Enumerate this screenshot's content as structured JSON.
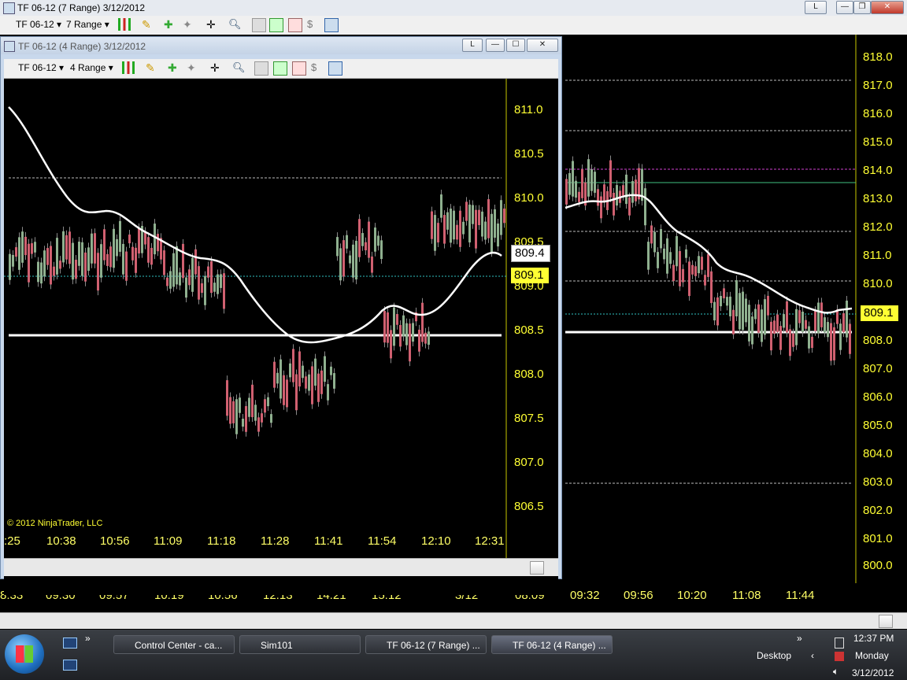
{
  "main_window": {
    "title": "TF 06-12 (7 Range)  3/12/2012",
    "instrument": "TF 06-12",
    "period": "7 Range",
    "restore_label": "L",
    "price_axis": [
      "818.0",
      "817.0",
      "816.0",
      "815.0",
      "814.0",
      "813.0",
      "812.0",
      "811.0",
      "810.0",
      "809.1",
      "808.0",
      "807.0",
      "806.0",
      "805.0",
      "804.0",
      "803.0",
      "802.0",
      "801.0",
      "800.0"
    ],
    "current_price": "809.1",
    "time_axis": [
      "8:33",
      "09:30",
      "09:57",
      "10:19",
      "10:56",
      "12:13",
      "14:21",
      "15:12",
      "3/12",
      "08:09",
      "09:32",
      "09:56",
      "10:20",
      "11:08",
      "11:44"
    ]
  },
  "inner_window": {
    "title": "TF 06-12 (4 Range)  3/12/2012",
    "instrument": "TF 06-12",
    "period": "4 Range",
    "restore_label": "L",
    "price_axis": [
      "811.0",
      "810.5",
      "810.0",
      "809.5",
      "809.0",
      "808.5",
      "808.0",
      "807.5",
      "807.0",
      "806.5"
    ],
    "price_tag_ma": "809.4",
    "price_tag_last": "809.1",
    "time_axis": [
      ":25",
      "10:38",
      "10:56",
      "11:09",
      "11:18",
      "11:28",
      "11:41",
      "11:54",
      "12:10",
      "12:31"
    ],
    "copyright": "© 2012 NinjaTrader, LLC"
  },
  "taskbar": {
    "buttons": [
      "Control Center - ca...",
      "Sim101",
      "TF 06-12 (7 Range) ...",
      "TF 06-12 (4 Range) ..."
    ],
    "desktop_label": "Desktop",
    "time": "12:37 PM",
    "day": "Monday",
    "date": "3/12/2012"
  },
  "colors": {
    "price": "#ffff33",
    "background": "#000000",
    "ma": "#ffffff",
    "pivot": "#ffffff"
  }
}
